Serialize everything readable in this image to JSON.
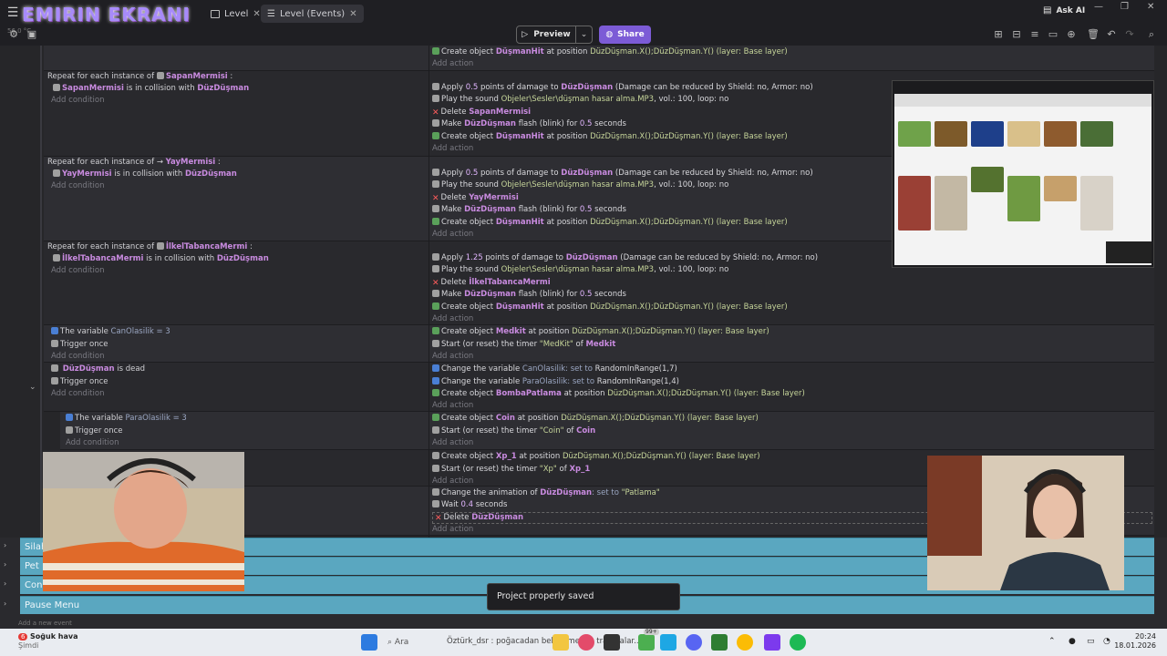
{
  "titlebar": {
    "stream_title": "EMIRIN EKRANI",
    "tabs": [
      {
        "label": "Level"
      },
      {
        "label": "Level (Events)"
      }
    ],
    "ask_ai": "Ask AI"
  },
  "toolbar": {
    "preview": "Preview",
    "share": "Share",
    "sys_left": "56.0 °C",
    "accent": "#7c5bd6"
  },
  "events": {
    "add_action": "Add action",
    "add_condition": "Add condition",
    "top_action": {
      "pre": "Create object",
      "obj": "DüşmanHit",
      "post": "at position",
      "pos": "DüzDüşman.X();DüzDüşman.Y()",
      "layer": "(layer: Base layer)"
    },
    "blocks": [
      {
        "repeat": "Repeat for each instance of",
        "repeat_obj": "SapanMermisi",
        "cond_obj": "SapanMermisi",
        "cond_mid": "is in collision with",
        "cond_target": "DüzDüşman",
        "a1": {
          "pre": "Apply",
          "n": "0.5",
          "mid": "points of damage to",
          "obj": "DüzDüşman",
          "tail": "(Damage can be reduced by Shield: no, Armor: no)"
        },
        "a2": {
          "pre": "Play the sound",
          "file": "Objeler\\Sesler\\düşman hasar alma.MP3",
          "tail": ", vol.: 100, loop: no"
        },
        "a3": {
          "pre": "Delete",
          "obj": "SapanMermisi"
        },
        "a4": {
          "pre": "Make",
          "obj": "DüzDüşman",
          "mid": "flash (blink) for",
          "n": "0.5",
          "tail": "seconds"
        },
        "a5": {
          "pre": "Create object",
          "obj": "DüşmanHit",
          "mid": "at position",
          "pos": "DüzDüşman.X();DüzDüşman.Y()",
          "tail": "(layer: Base layer)"
        }
      },
      {
        "repeat": "Repeat for each instance of",
        "repeat_obj": "YayMermisi",
        "cond_obj": "YayMermisi",
        "cond_mid": "is in collision with",
        "cond_target": "DüzDüşman",
        "a1": {
          "pre": "Apply",
          "n": "0.5",
          "mid": "points of damage to",
          "obj": "DüzDüşman",
          "tail": "(Damage can be reduced by Shield: no, Armor: no)"
        },
        "a2": {
          "pre": "Play the sound",
          "file": "Objeler\\Sesler\\düşman hasar alma.MP3",
          "tail": ", vol.: 100, loop: no"
        },
        "a3": {
          "pre": "Delete",
          "obj": "YayMermisi"
        },
        "a4": {
          "pre": "Make",
          "obj": "DüzDüşman",
          "mid": "flash (blink) for",
          "n": "0.5",
          "tail": "seconds"
        },
        "a5": {
          "pre": "Create object",
          "obj": "DüşmanHit",
          "mid": "at position",
          "pos": "DüzDüşman.X();DüzDüşman.Y()",
          "tail": "(layer: Base layer)"
        }
      },
      {
        "repeat": "Repeat for each instance of",
        "repeat_obj": "İlkelTabancaMermi",
        "cond_obj": "İlkelTabancaMermi",
        "cond_mid": "is in collision with",
        "cond_target": "DüzDüşman",
        "a1": {
          "pre": "Apply",
          "n": "1.25",
          "mid": "points of damage to",
          "obj": "DüzDüşman",
          "tail": "(Damage can be reduced by Shield: no, Armor: no)"
        },
        "a2": {
          "pre": "Play the sound",
          "file": "Objeler\\Sesler\\düşman hasar alma.MP3",
          "tail": ", vol.: 100, loop: no"
        },
        "a3": {
          "pre": "Delete",
          "obj": "İlkelTabancaMermi"
        },
        "a4": {
          "pre": "Make",
          "obj": "DüzDüşman",
          "mid": "flash (blink) for",
          "n": "0.5",
          "tail": "seconds"
        },
        "a5": {
          "pre": "Create object",
          "obj": "DüşmanHit",
          "mid": "at position",
          "pos": "DüzDüşman.X();DüzDüşman.Y()",
          "tail": "(layer: Base layer)"
        }
      }
    ],
    "medkit": {
      "c1": {
        "pre": "The variable",
        "var": "CanOlasilik",
        "tail": "= 3"
      },
      "c2": "Trigger once",
      "a1": {
        "pre": "Create object",
        "obj": "Medkit",
        "mid": "at position",
        "pos": "DüzDüşman.X();DüzDüşman.Y()",
        "tail": "(layer: Base layer)"
      },
      "a2": {
        "pre": "Start (or reset) the timer",
        "timer": "\"MedKit\"",
        "mid": "of",
        "obj": "Medkit"
      }
    },
    "dead": {
      "c1": {
        "obj": "DüzDüşman",
        "tail": "is dead"
      },
      "c2": "Trigger once",
      "a1": {
        "pre": "Change the variable",
        "var": "CanOlasilik",
        "mid": ": set to",
        "val": "RandomInRange(1,7)"
      },
      "a2": {
        "pre": "Change the variable",
        "var": "ParaOlasilik",
        "mid": ": set to",
        "val": "RandomInRange(1,4)"
      },
      "a3": {
        "pre": "Create object",
        "obj": "BombaPatlama",
        "mid": "at position",
        "pos": "DüzDüşman.X();DüzDüşman.Y()",
        "tail": "(layer: Base layer)"
      }
    },
    "coin": {
      "c1": {
        "pre": "The variable",
        "var": "ParaOlasilik",
        "tail": "= 3"
      },
      "c2": "Trigger once",
      "a1": {
        "pre": "Create object",
        "obj": "Coin",
        "mid": "at position",
        "pos": "DüzDüşman.X();DüzDüşman.Y()",
        "tail": "(layer: Base layer)"
      },
      "a2": {
        "pre": "Start (or reset) the timer",
        "timer": "\"Coin\"",
        "mid": "of",
        "obj": "Coin"
      }
    },
    "xp": {
      "a1": {
        "pre": "Create object",
        "obj": "Xp_1",
        "mid": "at position",
        "pos": "DüzDüşman.X();DüzDüşman.Y()",
        "tail": "(layer: Base layer)"
      },
      "a2": {
        "pre": "Start (or reset) the timer",
        "timer": "\"Xp\"",
        "mid": "of",
        "obj": "Xp_1"
      }
    },
    "anim": {
      "a1": {
        "pre": "Change the animation of",
        "obj": "DüzDüşman",
        "mid": ": set to",
        "val": "\"Patlama\""
      },
      "a2": {
        "pre": "Wait",
        "n": "0.4",
        "tail": "seconds"
      },
      "a3": {
        "pre": "Delete",
        "obj": "DüzDüşman"
      }
    }
  },
  "groups": [
    "Silah",
    "Pet",
    "Con",
    "Pause Menu"
  ],
  "add_new_event": "Add a new event",
  "toast": "Project properly saved",
  "taskbar": {
    "weather_title": "Soğuk hava",
    "weather_sub": "Şimdi",
    "badge": "6",
    "search": "Ara",
    "ticker": "Öztürk_dsr : poğacadan beklenmeyen travmalar...",
    "time": "20:24",
    "date": "18.01.2026",
    "apps_badge": "99+"
  }
}
